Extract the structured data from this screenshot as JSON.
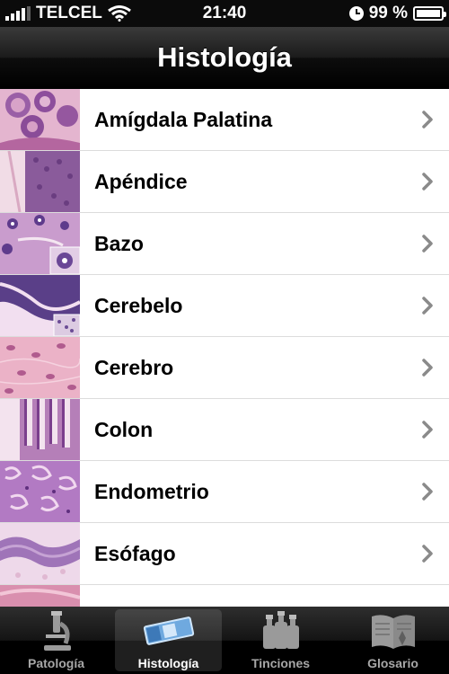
{
  "status_bar": {
    "carrier": "TELCEL",
    "time": "21:40",
    "battery": "99 %",
    "battery_level": 0.99
  },
  "nav": {
    "title": "Histología"
  },
  "items": [
    {
      "label": "Amígdala Palatina",
      "thumb": "tonsil-thumbnail"
    },
    {
      "label": "Apéndice",
      "thumb": "appendix-thumbnail"
    },
    {
      "label": "Bazo",
      "thumb": "spleen-thumbnail"
    },
    {
      "label": "Cerebelo",
      "thumb": "cerebellum-thumbnail"
    },
    {
      "label": "Cerebro",
      "thumb": "cerebrum-thumbnail"
    },
    {
      "label": "Colon",
      "thumb": "colon-thumbnail"
    },
    {
      "label": "Endometrio",
      "thumb": "endometrium-thumbnail"
    },
    {
      "label": "Esófago",
      "thumb": "esophagus-thumbnail"
    }
  ],
  "tabs": [
    {
      "label": "Patología",
      "icon": "microscope-icon",
      "active": false
    },
    {
      "label": "Histología",
      "icon": "slide-icon",
      "active": true
    },
    {
      "label": "Tinciones",
      "icon": "bottles-icon",
      "active": false
    },
    {
      "label": "Glosario",
      "icon": "book-icon",
      "active": false
    }
  ],
  "colors": {
    "accent_tissue_pink": "#e7a9c6",
    "accent_tissue_purple": "#7a3d8f",
    "chevron": "#8a8a8a",
    "separator": "#dcdcdc"
  }
}
